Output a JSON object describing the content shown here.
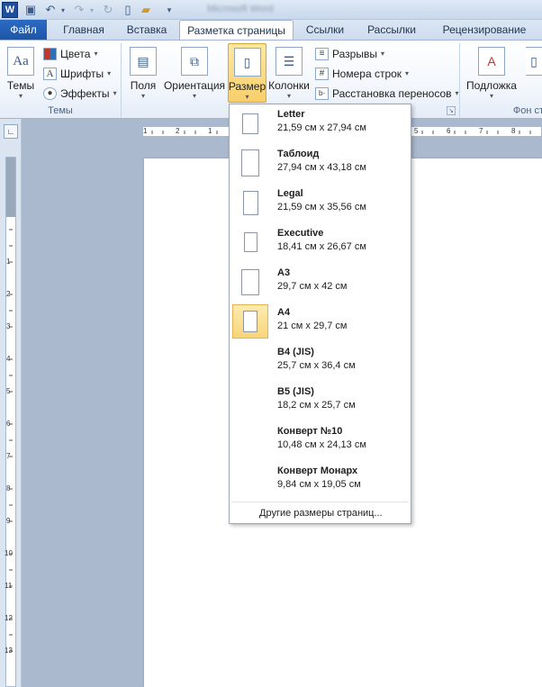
{
  "app": {
    "logo_letter": "W",
    "title": "Microsoft Word"
  },
  "tabs": {
    "file": "Файл",
    "items": [
      {
        "label": "Главная"
      },
      {
        "label": "Вставка"
      },
      {
        "label": "Разметка страницы"
      },
      {
        "label": "Ссылки"
      },
      {
        "label": "Рассылки"
      },
      {
        "label": "Рецензирование"
      }
    ]
  },
  "ribbon": {
    "themes": {
      "button": "Темы",
      "colors": "Цвета",
      "fonts": "Шрифты",
      "effects": "Эффекты",
      "group_label": "Темы"
    },
    "page_setup": {
      "margins": "Поля",
      "orientation": "Ориентация",
      "size": "Размер",
      "columns": "Колонки",
      "breaks": "Разрывы",
      "line_numbers": "Номера строк",
      "hyphenation": "Расстановка переносов"
    },
    "background": {
      "watermark": "Подложка",
      "group_label": "Фон стр"
    }
  },
  "size_menu": {
    "items": [
      {
        "name": "Letter",
        "dims": "21,59 см x 27,94 см"
      },
      {
        "name": "Таблоид",
        "dims": "27,94 см x 43,18 см"
      },
      {
        "name": "Legal",
        "dims": "21,59 см x 35,56 см"
      },
      {
        "name": "Executive",
        "dims": "18,41 см x 26,67 см"
      },
      {
        "name": "A3",
        "dims": "29,7 см x 42 см"
      },
      {
        "name": "A4",
        "dims": "21 см x 29,7 см"
      },
      {
        "name": "B4 (JIS)",
        "dims": "25,7 см x 36,4 см"
      },
      {
        "name": "B5 (JIS)",
        "dims": "18,2 см x 25,7 см"
      },
      {
        "name": "Конверт №10",
        "dims": "10,48 см x 24,13 см"
      },
      {
        "name": "Конверт Монарх",
        "dims": "9,84 см x 19,05 см"
      }
    ],
    "selected": "A4",
    "more": "Другие размеры страниц..."
  },
  "ruler": {
    "h_labels": [
      "1",
      "2",
      "1",
      "5",
      "6",
      "7",
      "8"
    ],
    "v_labels": [
      "1",
      "2",
      "3",
      "4",
      "5",
      "6",
      "7",
      "8",
      "9",
      "10",
      "11",
      "12",
      "13"
    ]
  }
}
